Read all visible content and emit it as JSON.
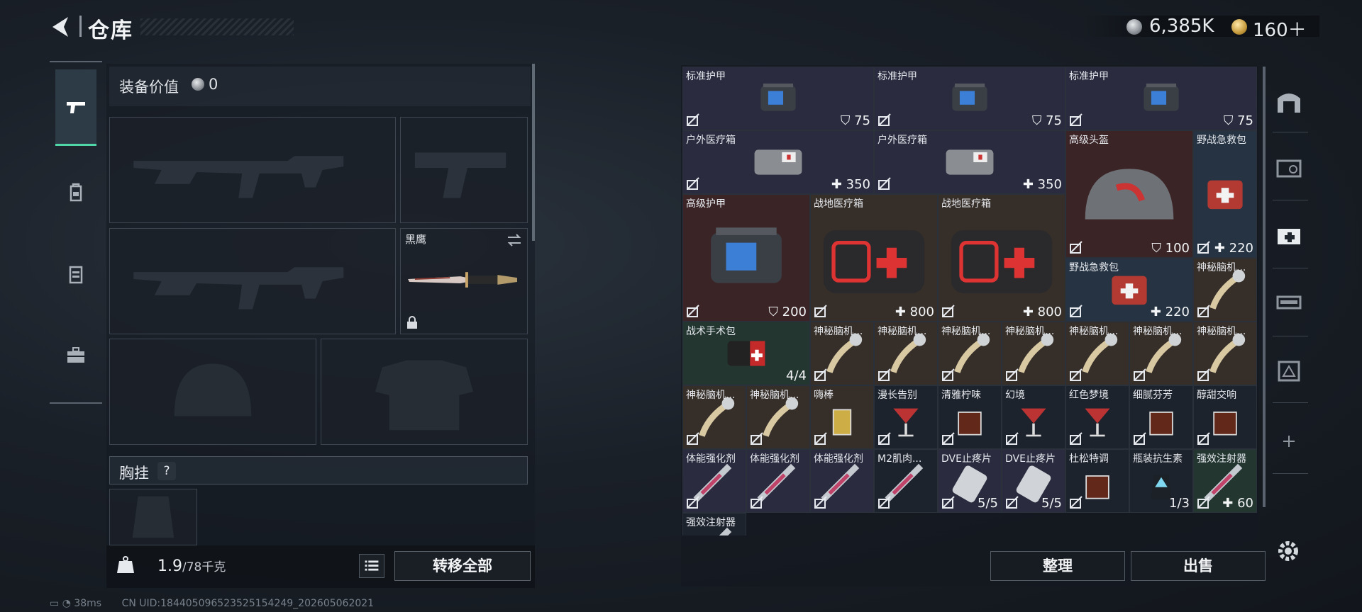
{
  "header": {
    "title": "仓库",
    "currency_a": "6,385K",
    "currency_b": "160＋"
  },
  "left_nav": [
    "weapon-tab",
    "backpack-tab",
    "vest-tab",
    "toolbox-tab"
  ],
  "equipment": {
    "value_label": "装备价值",
    "value": "0",
    "melee_slot_label": "黑鹰",
    "chest_rig_label": "胸挂",
    "help": "?",
    "weight_current": "1.9",
    "weight_max": "/78千克",
    "transfer_all": "转移全部"
  },
  "grid": {
    "items": [
      {
        "name": "标准护甲",
        "badge": "75"
      },
      {
        "name": "标准护甲",
        "badge": "75"
      },
      {
        "name": "标准护甲",
        "badge": "75"
      },
      {
        "name": "户外医疗箱",
        "badge": "350"
      },
      {
        "name": "户外医疗箱",
        "badge": "350"
      },
      {
        "name": "高级头盔",
        "badge": "100"
      },
      {
        "name": "野战急救包",
        "badge": "220"
      },
      {
        "name": "高级护甲",
        "badge": "200"
      },
      {
        "name": "战地医疗箱",
        "badge": "800"
      },
      {
        "name": "战地医疗箱",
        "badge": "800"
      },
      {
        "name": "野战急救包",
        "badge": "220"
      },
      {
        "name": "神秘脑机...",
        "badge": ""
      },
      {
        "name": "战术手术包",
        "badge": "4/4"
      },
      {
        "name": "神秘脑机...",
        "badge": ""
      },
      {
        "name": "神秘脑机...",
        "badge": ""
      },
      {
        "name": "神秘脑机...",
        "badge": ""
      },
      {
        "name": "神秘脑机...",
        "badge": ""
      },
      {
        "name": "神秘脑机...",
        "badge": ""
      },
      {
        "name": "神秘脑机...",
        "badge": ""
      },
      {
        "name": "神秘脑机...",
        "badge": ""
      },
      {
        "name": "神秘脑机...",
        "badge": ""
      },
      {
        "name": "神秘脑机...",
        "badge": ""
      },
      {
        "name": "嗨棒",
        "badge": ""
      },
      {
        "name": "漫长告别",
        "badge": ""
      },
      {
        "name": "清雅柠味",
        "badge": ""
      },
      {
        "name": "幻境",
        "badge": ""
      },
      {
        "name": "红色梦境",
        "badge": ""
      },
      {
        "name": "细腻芬芳",
        "badge": ""
      },
      {
        "name": "醇甜交响",
        "badge": ""
      },
      {
        "name": "体能强化剂",
        "badge": ""
      },
      {
        "name": "体能强化剂",
        "badge": ""
      },
      {
        "name": "体能强化剂",
        "badge": ""
      },
      {
        "name": "M2肌肉...",
        "badge": ""
      },
      {
        "name": "DVE止疼片",
        "badge": "5/5"
      },
      {
        "name": "DVE止疼片",
        "badge": "5/5"
      },
      {
        "name": "杜松特调",
        "badge": ""
      },
      {
        "name": "瓶装抗生素",
        "badge": "1/3"
      },
      {
        "name": "强效注射器",
        "badge": "60"
      },
      {
        "name": "强效注射器",
        "badge": ""
      }
    ],
    "sort": "整理",
    "sell": "出售"
  },
  "status": {
    "ping": "38ms",
    "uid": "CN UID:1844050965235251542​49_202605062021"
  },
  "colors": {
    "accent": "#4fd7a7",
    "panel": "#1f2631"
  }
}
